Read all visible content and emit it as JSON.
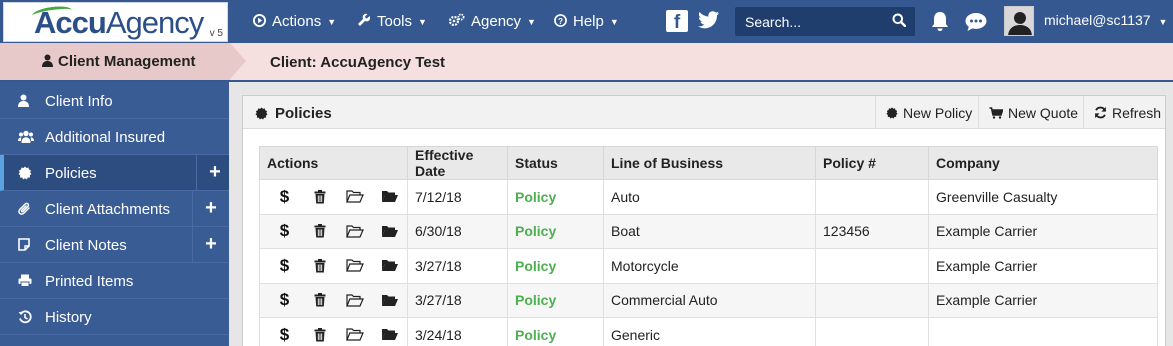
{
  "app": {
    "logo_text_accu": "Accu",
    "logo_text_agency": "Agency",
    "logo_version": "v 5"
  },
  "topnav": {
    "items": [
      {
        "label": "Actions",
        "icon": "play-circle-icon"
      },
      {
        "label": "Tools",
        "icon": "wrench-icon"
      },
      {
        "label": "Agency",
        "icon": "cogs-icon"
      },
      {
        "label": "Help",
        "icon": "question-circle-icon"
      }
    ],
    "search_placeholder": "Search...",
    "username": "michael@sc1137"
  },
  "breadcrumb": {
    "section": "Client Management",
    "client": "Client: AccuAgency Test"
  },
  "sidebar": {
    "items": [
      {
        "label": "Client Info",
        "icon": "user-icon"
      },
      {
        "label": "Additional Insured",
        "icon": "users-icon"
      },
      {
        "label": "Policies",
        "icon": "certificate-icon",
        "plus": "+"
      },
      {
        "label": "Client Attachments",
        "icon": "paperclip-icon",
        "plus": "+"
      },
      {
        "label": "Client Notes",
        "icon": "note-icon",
        "plus": "+"
      },
      {
        "label": "Printed Items",
        "icon": "print-icon"
      },
      {
        "label": "History",
        "icon": "history-icon"
      }
    ]
  },
  "panel": {
    "title": "Policies",
    "new_policy": "New Policy",
    "new_quote": "New Quote",
    "refresh": "Refresh"
  },
  "table": {
    "headers": [
      "Actions",
      "Effective Date",
      "Status",
      "Line of Business",
      "Policy #",
      "Company"
    ],
    "rows": [
      {
        "date": "7/12/18",
        "status": "Policy",
        "lob": "Auto",
        "policy": "",
        "company": "Greenville Casualty"
      },
      {
        "date": "6/30/18",
        "status": "Policy",
        "lob": "Boat",
        "policy": "123456",
        "company": "Example Carrier"
      },
      {
        "date": "3/27/18",
        "status": "Policy",
        "lob": "Motorcycle",
        "policy": "",
        "company": "Example Carrier"
      },
      {
        "date": "3/27/18",
        "status": "Policy",
        "lob": "Commercial Auto",
        "policy": "",
        "company": "Example Carrier"
      },
      {
        "date": "3/24/18",
        "status": "Policy",
        "lob": "Generic",
        "policy": "",
        "company": ""
      }
    ],
    "action_dollar": "$"
  },
  "colors": {
    "topbar": "#34588f",
    "sidebar": "#3a5c95",
    "status_green": "#4caf50",
    "breadcrumb_bg": "#f5dfdf"
  }
}
